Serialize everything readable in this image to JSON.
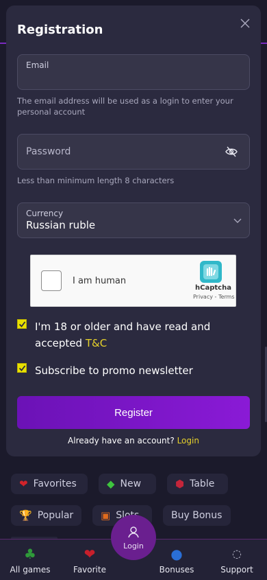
{
  "background": {
    "chips": [
      {
        "label": "Favorites",
        "icon": "heart-icon"
      },
      {
        "label": "New",
        "icon": "diamond-icon"
      },
      {
        "label": "Table",
        "icon": "dice-icon"
      },
      {
        "label": "Popular",
        "icon": "trophy-icon"
      },
      {
        "label": "Slots",
        "icon": "slot-machine-icon"
      },
      {
        "label": "Buy Bonus",
        "icon": ""
      }
    ],
    "nav": {
      "all_games": "All games",
      "favorite": "Favorite",
      "login": "Login",
      "bonuses": "Bonuses",
      "support": "Support"
    }
  },
  "modal": {
    "title": "Registration",
    "email": {
      "label": "Email",
      "value": "",
      "hint": "The email address will be used as a login to enter your personal account"
    },
    "password": {
      "placeholder": "Password",
      "hint": "Less than minimum length 8 characters"
    },
    "currency": {
      "label": "Currency",
      "value": "Russian ruble"
    },
    "captcha": {
      "label": "I am human",
      "brand": "hCaptcha",
      "legal": "Privacy - Terms"
    },
    "age_check": {
      "text": "I'm 18 or older and have read and accepted ",
      "link": "T&C",
      "checked": true
    },
    "newsletter": {
      "text": "Subscribe to promo newsletter",
      "checked": true
    },
    "register_label": "Register",
    "already_text": "Already have an account? ",
    "already_link": "Login"
  },
  "colors": {
    "accent": "#8a1ad6",
    "link": "#e6d12b",
    "checkbox": "#e8e000",
    "modal_bg": "#2b2a3f"
  }
}
